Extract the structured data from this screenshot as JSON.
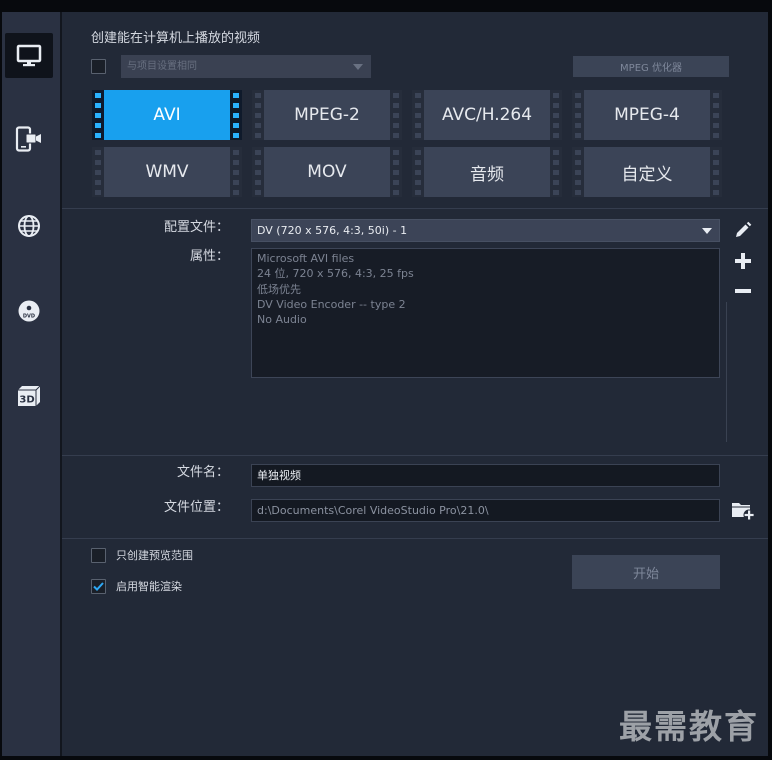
{
  "sidebar": {
    "items": [
      {
        "icon": "monitor-icon",
        "selected": true
      },
      {
        "icon": "mobile-camera-icon",
        "selected": false
      },
      {
        "icon": "globe-icon",
        "selected": false
      },
      {
        "icon": "dvd-disc-icon",
        "label": "DVD",
        "selected": false
      },
      {
        "icon": "3d-icon",
        "label": "3D",
        "selected": false
      }
    ]
  },
  "header": {
    "title": "创建能在计算机上播放的视频"
  },
  "project_settings": {
    "checked": false,
    "value": "与项目设置相同",
    "enabled": false
  },
  "mpeg_optimizer": {
    "label": "MPEG 优化器",
    "enabled": false
  },
  "formats": [
    {
      "label": "AVI",
      "selected": true
    },
    {
      "label": "MPEG-2",
      "selected": false
    },
    {
      "label": "AVC/H.264",
      "selected": false
    },
    {
      "label": "MPEG-4",
      "selected": false
    },
    {
      "label": "WMV",
      "selected": false
    },
    {
      "label": "MOV",
      "selected": false
    },
    {
      "label": "音频",
      "selected": false
    },
    {
      "label": "自定义",
      "selected": false
    }
  ],
  "profile": {
    "label": "配置文件：",
    "value": "DV (720 x 576, 4:3, 50i) - 1"
  },
  "properties": {
    "label": "属性：",
    "lines": [
      "Microsoft AVI files",
      "24 位, 720 x 576, 4:3, 25 fps",
      "低场优先",
      "DV Video Encoder -- type 2",
      "No Audio"
    ]
  },
  "profile_tools": {
    "icons": [
      "pencil-icon",
      "plus-icon",
      "minus-icon"
    ]
  },
  "file": {
    "name_label": "文件名：",
    "name_value": "单独视频",
    "location_label": "文件位置：",
    "location_value": "d:\\Documents\\Corel VideoStudio Pro\\21.0\\",
    "browse_icon": "folder-add-icon"
  },
  "options": {
    "preview_range": {
      "label": "只创建预览范围",
      "checked": false
    },
    "smart_render": {
      "label": "启用智能渲染",
      "checked": true
    }
  },
  "start_button": {
    "label": "开始",
    "enabled": false
  },
  "watermark": "最需教育",
  "colors": {
    "accent": "#18a0ee",
    "background": "#222937",
    "sidebar": "#2a3142",
    "checkmark": "#2ea8f5",
    "button": "#3b4457"
  }
}
